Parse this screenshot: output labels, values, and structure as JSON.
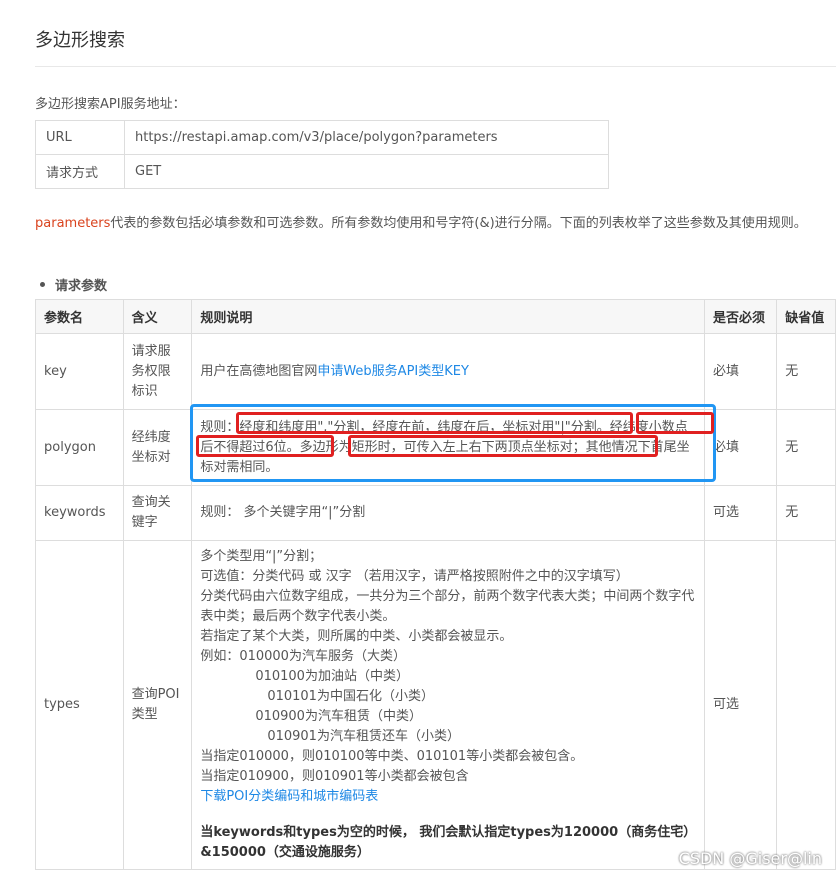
{
  "page_title": "多边形搜索",
  "intro": "多边形搜索API服务地址：",
  "service": {
    "url_label": "URL",
    "url_value": "https://restapi.amap.com/v3/place/polygon?parameters",
    "method_label": "请求方式",
    "method_value": "GET"
  },
  "description": {
    "highlight": "parameters",
    "text": "代表的参数包括必填参数和可选参数。所有参数均使用和号字符(&)进行分隔。下面的列表枚举了这些参数及其使用规则。"
  },
  "params_heading": "请求参数",
  "table": {
    "headers": [
      "参数名",
      "含义",
      "规则说明",
      "是否必须",
      "缺省值"
    ],
    "key": {
      "name": "key",
      "meaning": "请求服务权限标识",
      "rule_prefix": "用户在高德地图官网",
      "rule_link": "申请Web服务API类型KEY",
      "required": "必填",
      "default": "无"
    },
    "polygon": {
      "name": "polygon",
      "meaning": "经纬度坐标对",
      "rule": "规则：经度和纬度用\",\"分割，经度在前，纬度在后，坐标对用\"|\"分割。经纬度小数点后不得超过6位。多边形为矩形时，可传入左上右下两顶点坐标对；其他情况下首尾坐标对需相同。",
      "required": "必填",
      "default": "无"
    },
    "keywords": {
      "name": "keywords",
      "meaning": "查询关键字",
      "rule": "规则： 多个关键字用“|”分割",
      "required": "可选",
      "default": "无"
    },
    "types": {
      "name": "types",
      "meaning": "查询POI类型",
      "lines": [
        "多个类型用“|”分割；",
        "可选值：分类代码 或 汉字 （若用汉字，请严格按照附件之中的汉字填写）",
        "分类代码由六位数字组成，一共分为三个部分，前两个数字代表大类；中间两个数字代表中类；最后两个数字代表小类。",
        "若指定了某个大类，则所属的中类、小类都会被显示。",
        "例如：010000为汽车服务（大类）"
      ],
      "examples": [
        {
          "text": "010100为加油站（中类）",
          "level": 1
        },
        {
          "text": "010101为中国石化（小类）",
          "level": 2
        },
        {
          "text": "010900为汽车租赁（中类）",
          "level": 1
        },
        {
          "text": "010901为汽车租赁还车（小类）",
          "level": 2
        }
      ],
      "tail_lines": [
        "当指定010000，则010100等中类、010101等小类都会被包含。",
        "当指定010900，则010901等小类都会被包含"
      ],
      "download_link": "下载POI分类编码和城市编码表",
      "note": "当keywords和types为空的时候， 我们会默认指定types为120000（商务住宅）&150000（交通设施服务）",
      "required": "可选",
      "default": ""
    }
  },
  "watermark": "CSDN @Giser@lin",
  "colors": {
    "accent_red": "#e02020",
    "accent_blue": "#2196f3",
    "link": "#1e88e5",
    "highlight": "#d9431e"
  }
}
